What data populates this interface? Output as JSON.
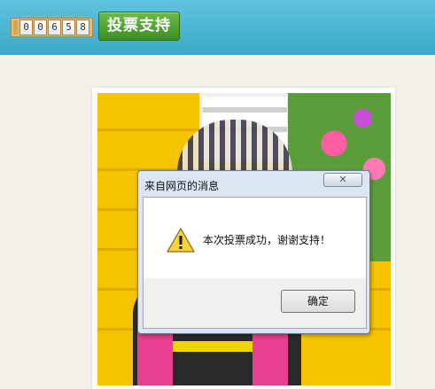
{
  "header": {
    "vote_count_digits": [
      "0",
      "0",
      "6",
      "5",
      "8"
    ],
    "vote_button_label": "投票支持"
  },
  "dialog": {
    "title": "来自网页的消息",
    "close_glyph": "☒",
    "message": "本次投票成功，谢谢支持！",
    "ok_label": "确定",
    "icon": "warning-icon"
  },
  "colors": {
    "header_bg": "#4bb6d4",
    "vote_button": "#4a9e30",
    "dialog_bg": "#dbe6f2",
    "warning_yellow": "#f7d33b"
  }
}
